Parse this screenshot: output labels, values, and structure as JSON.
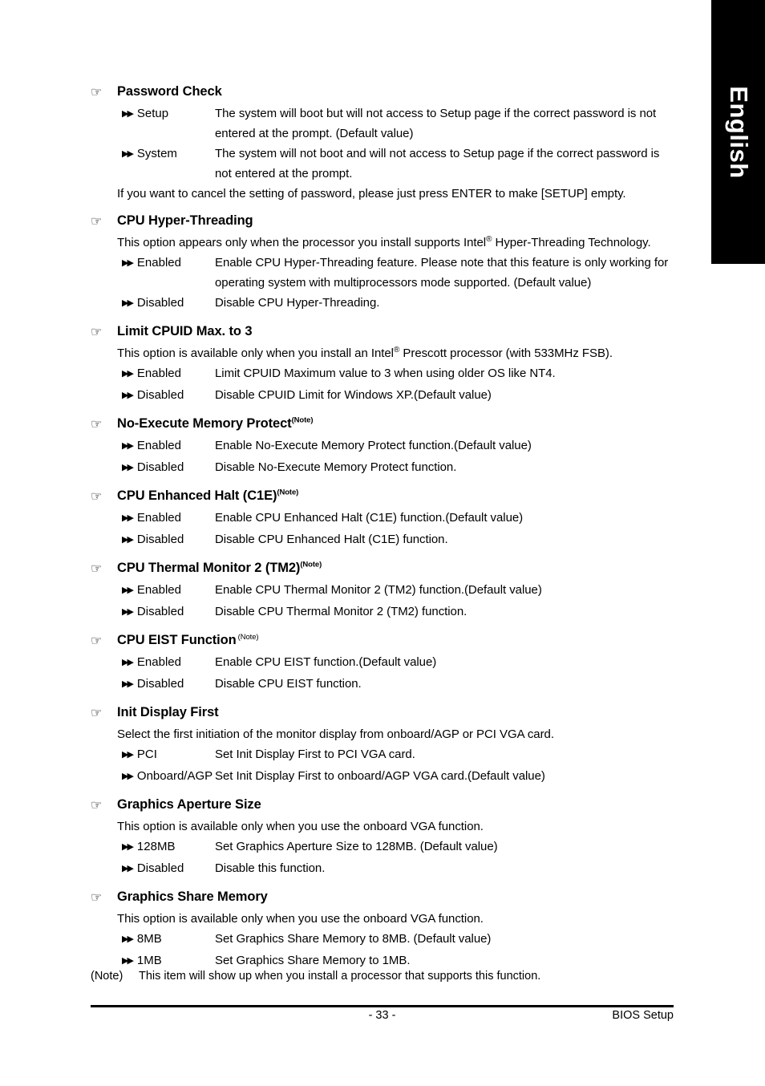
{
  "language_tab": {
    "label": "English",
    "background": "#000000",
    "text_color": "#ffffff"
  },
  "markers": {
    "section_bullet": "☞",
    "option_arrow": "▶▶"
  },
  "sections": [
    {
      "title": "Password Check",
      "note_sup": "",
      "desc": "",
      "options": [
        {
          "label": "Setup",
          "desc": "The system will boot but will not access to Setup page if the correct password is not entered at the prompt. (Default value)"
        },
        {
          "label": "System",
          "desc": "The system will not boot and will not access to Setup page if the correct password is not entered at the prompt."
        }
      ],
      "trailing": "If you want to cancel the setting of password, please just press ENTER to make [SETUP] empty."
    },
    {
      "title": "CPU Hyper-Threading",
      "note_sup": "",
      "desc_prefix": "This option appears only when the processor you install supports Intel",
      "desc_sup": "®",
      "desc_suffix": " Hyper-Threading Technology.",
      "options": [
        {
          "label": "Enabled",
          "desc": "Enable CPU Hyper-Threading feature. Please note that this feature is only working  for operating system with multiprocessors mode supported. (Default value)"
        },
        {
          "label": "Disabled",
          "desc": "Disable CPU Hyper-Threading."
        }
      ],
      "trailing": ""
    },
    {
      "title": "Limit CPUID Max. to 3",
      "note_sup": "",
      "desc_prefix": "This option is available only when you install an Intel",
      "desc_sup": "®",
      "desc_suffix": " Prescott processor (with 533MHz FSB).",
      "options": [
        {
          "label": "Enabled",
          "desc": "Limit CPUID Maximum value to 3 when using older OS like NT4."
        },
        {
          "label": "Disabled",
          "desc": "Disable CPUID Limit for Windows XP.(Default value)"
        }
      ],
      "trailing": ""
    },
    {
      "title": "No-Execute Memory Protect",
      "note_sup": "(Note)",
      "desc": "",
      "options": [
        {
          "label": "Enabled",
          "desc": "Enable No-Execute Memory Protect function.(Default value)"
        },
        {
          "label": "Disabled",
          "desc": "Disable No-Execute Memory Protect function."
        }
      ],
      "trailing": ""
    },
    {
      "title": "CPU Enhanced Halt (C1E)",
      "note_sup": "(Note)",
      "desc": "",
      "options": [
        {
          "label": "Enabled",
          "desc": "Enable CPU Enhanced Halt (C1E) function.(Default value)"
        },
        {
          "label": "Disabled",
          "desc": "Disable CPU Enhanced Halt (C1E) function."
        }
      ],
      "trailing": ""
    },
    {
      "title": "CPU Thermal Monitor 2 (TM2)",
      "note_sup": "(Note)",
      "desc": "",
      "options": [
        {
          "label": "Enabled",
          "desc": "Enable CPU Thermal Monitor 2 (TM2) function.(Default value)"
        },
        {
          "label": "Disabled",
          "desc": "Disable CPU Thermal Monitor 2 (TM2) function."
        }
      ],
      "trailing": ""
    },
    {
      "title": "CPU EIST Function",
      "note_sup": "(Note)",
      "note_regular": true,
      "desc": "",
      "options": [
        {
          "label": "Enabled",
          "desc": "Enable CPU EIST function.(Default value)"
        },
        {
          "label": "Disabled",
          "desc": "Disable CPU EIST function."
        }
      ],
      "trailing": ""
    },
    {
      "title": "Init Display First",
      "note_sup": "",
      "desc": "Select the first initiation of the monitor display from onboard/AGP or PCI VGA card.",
      "options": [
        {
          "label": "PCI",
          "desc": "Set Init Display First to PCI VGA card."
        },
        {
          "label": "Onboard/AGP",
          "desc": "Set Init Display First to onboard/AGP VGA card.(Default value)"
        }
      ],
      "trailing": ""
    },
    {
      "title": "Graphics Aperture Size",
      "note_sup": "",
      "desc": "This option is available only when you use the onboard VGA function.",
      "options": [
        {
          "label": "128MB",
          "desc": "Set Graphics Aperture Size to 128MB. (Default value)"
        },
        {
          "label": "Disabled",
          "desc": "Disable this function."
        }
      ],
      "trailing": ""
    },
    {
      "title": "Graphics Share Memory",
      "note_sup": "",
      "desc": "This option is available only when you use the onboard VGA function.",
      "options": [
        {
          "label": "8MB",
          "desc": "Set Graphics Share Memory to 8MB. (Default value)"
        },
        {
          "label": "1MB",
          "desc": "Set Graphics Share Memory to 1MB."
        }
      ],
      "trailing": ""
    }
  ],
  "footnote": {
    "tag": "(Note)",
    "text": "This item will show up when you install a processor that supports this function."
  },
  "footer": {
    "page_number": "- 33 -",
    "right_label": "BIOS Setup"
  }
}
